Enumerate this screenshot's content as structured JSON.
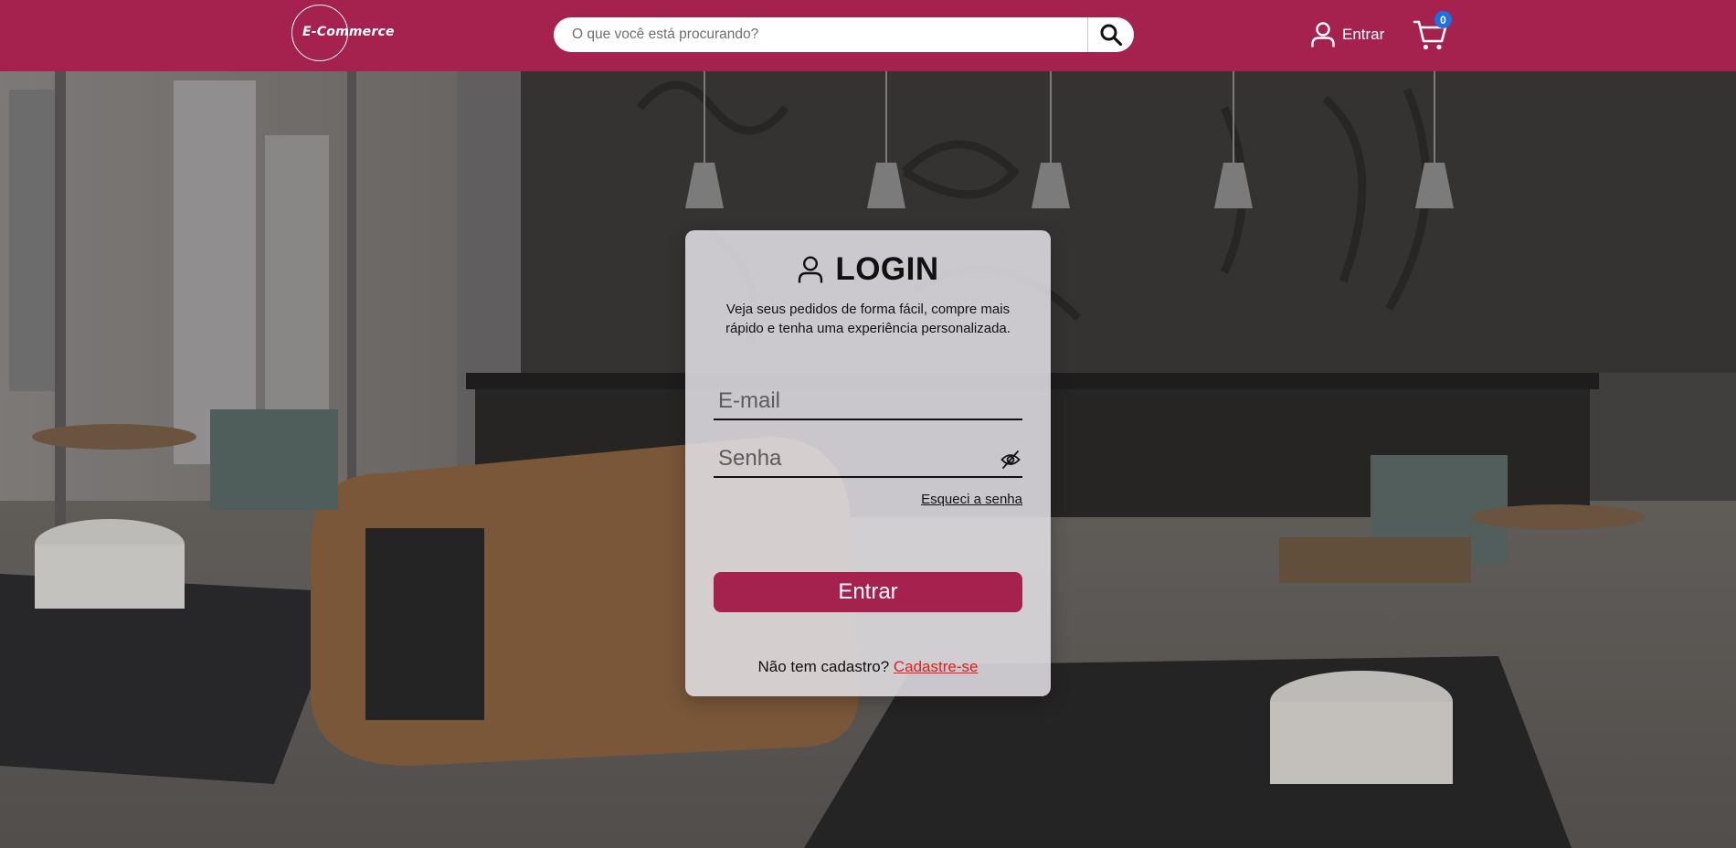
{
  "header": {
    "logo_text": "E-Commerce",
    "search": {
      "placeholder": "O que você está procurando?",
      "value": ""
    },
    "login_label": "Entrar",
    "cart_count": "0"
  },
  "login_card": {
    "title": "LOGIN",
    "subtitle_line1": "Veja seus pedidos de forma fácil, compre mais",
    "subtitle_line2": "rápido e tenha uma experiência personalizada.",
    "email_placeholder": "E-mail",
    "password_placeholder": "Senha",
    "forgot_label": "Esqueci a senha",
    "submit_label": "Entrar",
    "signup_prompt": "Não tem cadastro?",
    "signup_link": "Cadastre-se"
  },
  "colors": {
    "brand": "#a5214e",
    "badge": "#1e6fe0",
    "link": "#e01f1f"
  },
  "icons": [
    "search-icon",
    "user-icon",
    "cart-icon",
    "eye-off-icon"
  ]
}
